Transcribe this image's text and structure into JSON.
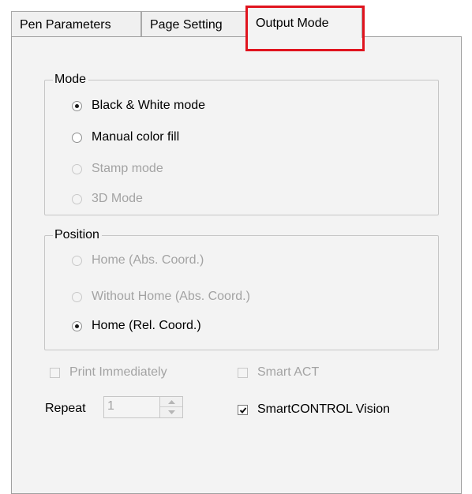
{
  "tabs": [
    {
      "label": "Pen Parameters",
      "active": false
    },
    {
      "label": "Page Setting",
      "active": false
    },
    {
      "label": "Output Mode",
      "active": true
    }
  ],
  "mode_group": {
    "title": "Mode",
    "options": [
      {
        "label": "Black & White mode",
        "checked": true,
        "enabled": true
      },
      {
        "label": "Manual color fill",
        "checked": false,
        "enabled": true
      },
      {
        "label": "Stamp mode",
        "checked": false,
        "enabled": false
      },
      {
        "label": "3D Mode",
        "checked": false,
        "enabled": false
      }
    ]
  },
  "position_group": {
    "title": "Position",
    "options": [
      {
        "label": "Home (Abs. Coord.)",
        "checked": false,
        "enabled": false
      },
      {
        "label": "Without Home (Abs. Coord.)",
        "checked": false,
        "enabled": false
      },
      {
        "label": "Home (Rel. Coord.)",
        "checked": true,
        "enabled": true
      }
    ]
  },
  "print_immediately": {
    "label": "Print Immediately",
    "checked": false,
    "enabled": false
  },
  "smart_act": {
    "label": "Smart ACT",
    "checked": false,
    "enabled": false
  },
  "repeat": {
    "label": "Repeat",
    "value": "1",
    "enabled": false
  },
  "smartcontrol_vision": {
    "label": "SmartCONTROL Vision",
    "checked": true,
    "enabled": true
  },
  "colors": {
    "highlight": "#e0141e",
    "panel_background": "#f3f3f3",
    "disabled_text": "#a3a3a3"
  }
}
